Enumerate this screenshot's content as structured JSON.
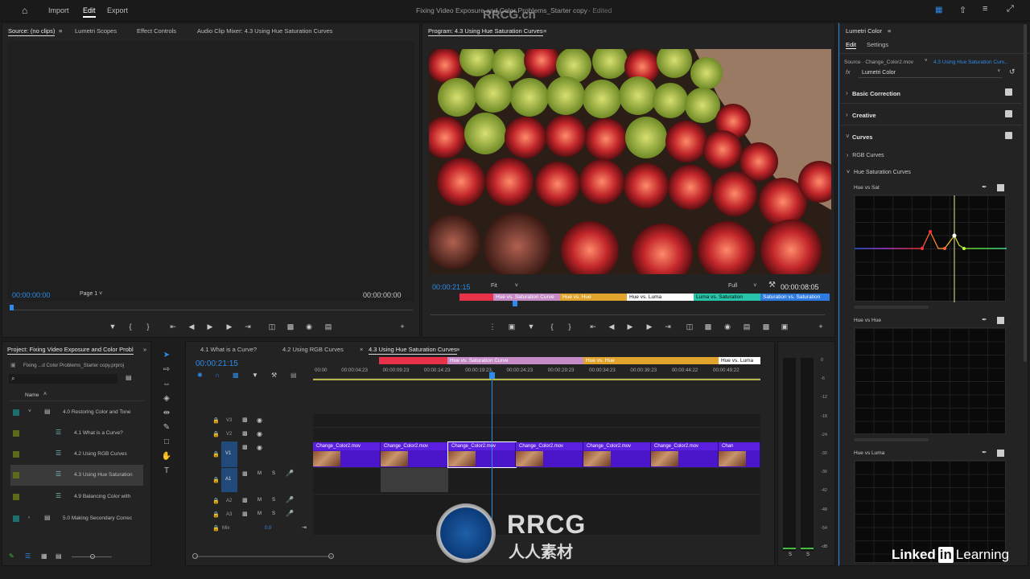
{
  "app": {
    "title": "Fixing Video Exposure and Color Problems_Starter copy",
    "edited": "- Edited",
    "nav": {
      "import": "Import",
      "edit": "Edit",
      "export": "Export"
    }
  },
  "source_panel": {
    "tabs": [
      "Source: (no clips)",
      "Lumetri Scopes",
      "Effect Controls",
      "Audio Clip Mixer: 4.3 Using Hue Saturation Curves"
    ],
    "timecode_left": "00:00:00:00",
    "page": "Page 1",
    "timecode_right": "00:00:00:00"
  },
  "program_panel": {
    "title": "Program: 4.3 Using Hue Saturation Curves",
    "timecode": "00:00:21:15",
    "fit": "Fit",
    "quality": "Full",
    "duration": "00:00:08:05",
    "labels": [
      {
        "text": "",
        "color": "#e8324a"
      },
      {
        "text": "Hue vs. Saturation Curve",
        "color": "#c58bc7"
      },
      {
        "text": "Hue vs. Hue",
        "color": "#e0a42c"
      },
      {
        "text": "Hue vs. Luma",
        "color": "#ffffff"
      },
      {
        "text": "Luma vs. Saturation",
        "color": "#26c4a8"
      },
      {
        "text": "Saturation vs. Saturation",
        "color": "#2d7ae0"
      }
    ]
  },
  "project_panel": {
    "title": "Project: Fixing Video Exposure and Color Probl",
    "file": "Fixing ...d Color Problems_Starter copy.prproj",
    "column": "Name",
    "items": [
      {
        "name": "4.0 Restoring Color and Tone",
        "color": "#1e6e6e",
        "type": "folder"
      },
      {
        "name": "4.1 What is a Curve?",
        "color": "#5c6a1a",
        "type": "sequence"
      },
      {
        "name": "4.2 Using RGB Curves",
        "color": "#5c6a1a",
        "type": "sequence"
      },
      {
        "name": "4.3 Using Hue Saturation",
        "color": "#5c6a1a",
        "type": "sequence"
      },
      {
        "name": "4.9 Balancing Color with",
        "color": "#5c6a1a",
        "type": "sequence"
      },
      {
        "name": "5.0 Making Secondary Correc",
        "color": "#1e6e6e",
        "type": "folder"
      }
    ]
  },
  "timeline": {
    "tabs": [
      "4.1 What is a Curve?",
      "4.2 Using RGB Curves",
      "4.3 Using Hue Saturation Curves"
    ],
    "timecode": "00:00:21:15",
    "ruler": [
      "00:00",
      "00:00:04:23",
      "00:00:09:23",
      "00:00:14:23",
      "00:00:19:23",
      "00:00:24:23",
      "00:00:29:23",
      "00:00:34:23",
      "00:00:39:23",
      "00:00:44:22",
      "00:00:49:22"
    ],
    "markers": [
      {
        "text": "",
        "color": "#e8324a"
      },
      {
        "text": "Hue vs. Saturation Curve",
        "color": "#c58bc7"
      },
      {
        "text": "Hue vs. Hue",
        "color": "#e0a42c"
      },
      {
        "text": "Hue vs. Luma",
        "color": "#ffffff"
      }
    ],
    "tracks": [
      "V3",
      "V2",
      "V1",
      "A1",
      "A2",
      "A3"
    ],
    "mix_label": "Mix",
    "mix_value": "0.0",
    "clips": [
      "Change_Color2.mov",
      "Change_Color2.mov",
      "Change_Color2.mov",
      "Change_Color2.mov",
      "Change_Color2.mov",
      "Change_Color2.mov",
      "Chan"
    ],
    "meter_ticks": [
      "0",
      "-6",
      "-12",
      "-18",
      "-24",
      "-30",
      "-36",
      "-42",
      "-48",
      "-54",
      "-dB"
    ],
    "meter_solo": [
      "S",
      "S"
    ]
  },
  "lumetri": {
    "title": "Lumetri Color",
    "tabs": [
      "Edit",
      "Settings"
    ],
    "source": "Source · Change_Color2.mov",
    "sequence": "4.3 Using Hue Saturation Curv...",
    "effect": "Lumetri Color",
    "fx": "fx",
    "sections": [
      "Basic Correction",
      "Creative",
      "Curves"
    ],
    "subsections": [
      "RGB Curves",
      "Hue Saturation Curves"
    ],
    "curves": [
      "Hue vs Sat",
      "Hue vs Hue",
      "Hue vs Luma"
    ]
  },
  "branding": {
    "watermark": "RRCG.cn",
    "logo_main": "RRCG",
    "logo_sub": "人人素材",
    "linkedin": "Learning",
    "linkedin_prefix": "Linked"
  }
}
